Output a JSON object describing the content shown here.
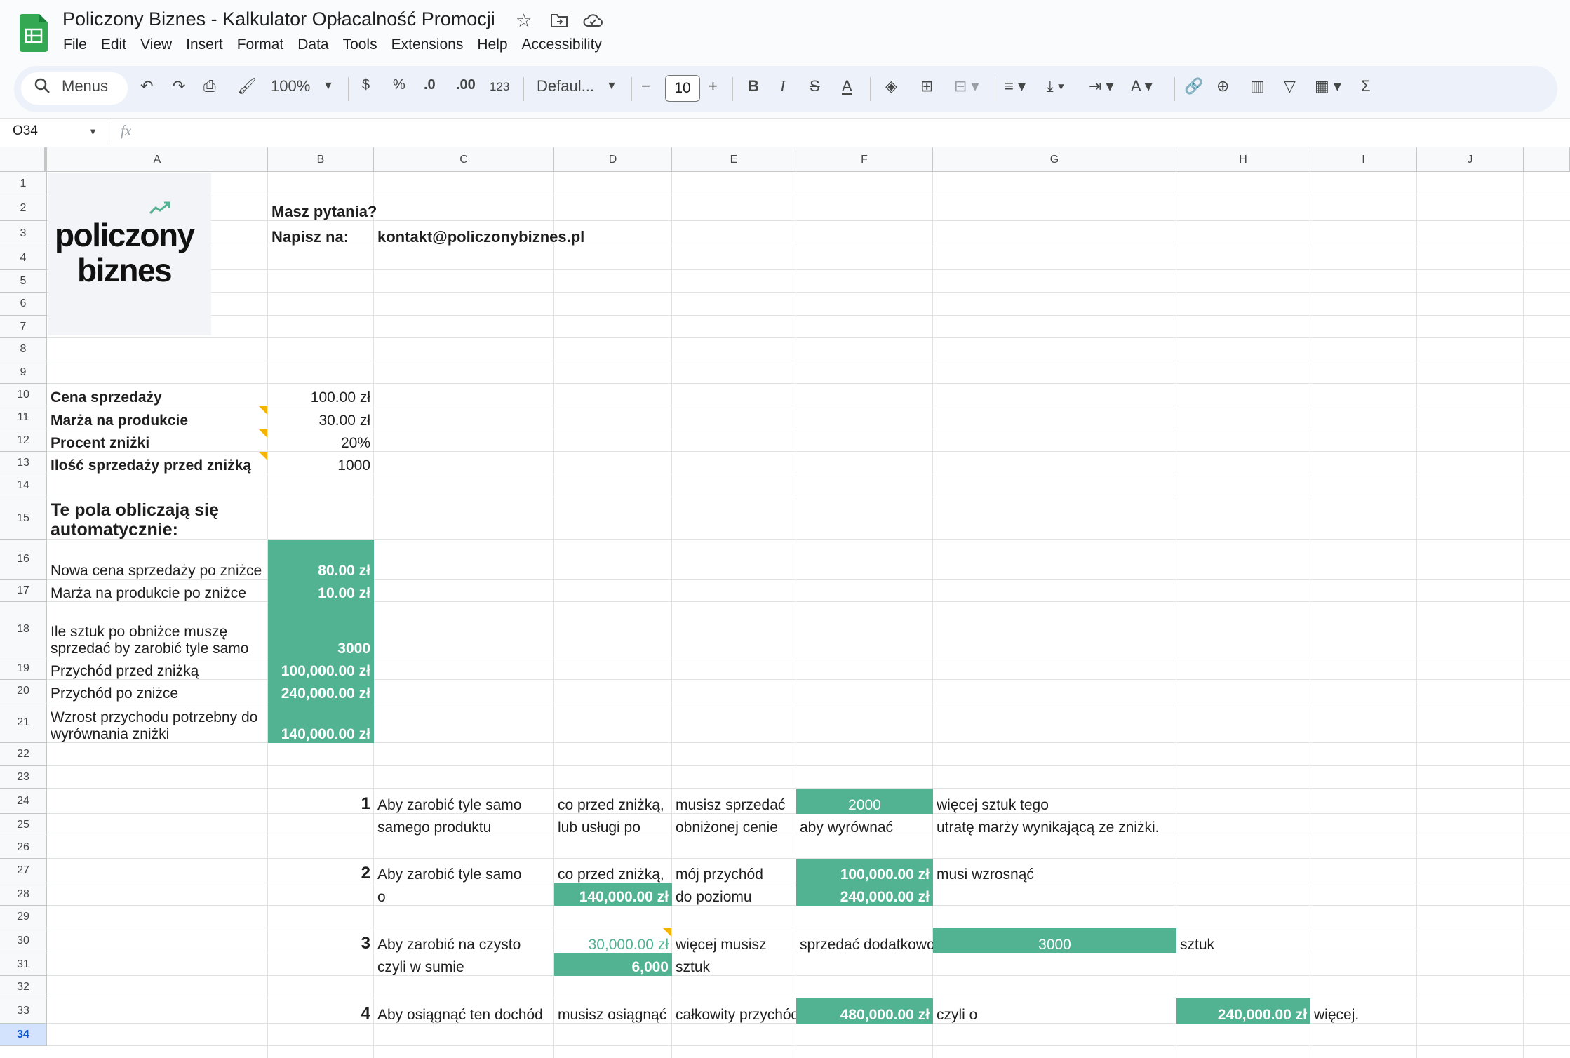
{
  "title": "Policzony Biznes - Kalkulator Opłacalność Promocji",
  "menu": [
    "File",
    "Edit",
    "View",
    "Insert",
    "Format",
    "Data",
    "Tools",
    "Extensions",
    "Help",
    "Accessibility"
  ],
  "toolbar": {
    "search": "Menus",
    "zoom": "100%",
    "currency": "$",
    "percent": "%",
    "dec_less": ".0",
    "dec_more": ".00",
    "num_format": "123",
    "font": "Defaul...",
    "font_size": "10",
    "bold": "B",
    "italic": "I"
  },
  "name_box": "O34",
  "fx": "fx",
  "columns": [
    "A",
    "B",
    "C",
    "D",
    "E",
    "F",
    "G",
    "H",
    "I",
    "J"
  ],
  "rows": [
    "1",
    "2",
    "3",
    "4",
    "5",
    "6",
    "7",
    "8",
    "9",
    "10",
    "11",
    "12",
    "13",
    "14",
    "15",
    "16",
    "17",
    "18",
    "19",
    "20",
    "21",
    "22",
    "23",
    "24",
    "25",
    "26",
    "27",
    "28",
    "29",
    "30",
    "31",
    "32",
    "33",
    "34"
  ],
  "logo": {
    "line1": "policzony",
    "line2": "biznes"
  },
  "contact": {
    "q": "Masz pytania?",
    "write": "Napisz na:",
    "email": "kontakt@policzonybiznes.pl"
  },
  "inputs": {
    "price_label": "Cena sprzedaży",
    "price": "100.00 zł",
    "margin_label": "Marża na produkcie",
    "margin": "30.00 zł",
    "discount_label": "Procent zniżki",
    "discount": "20%",
    "qty_label": "Ilość sprzedaży przed zniżką",
    "qty": "1000"
  },
  "auto": {
    "heading": "Te pola obliczają się automatycznie:",
    "new_price_label": "Nowa cena sprzedaży po zniżce",
    "new_price": "80.00 zł",
    "new_margin_label": "Marża na produkcie po zniżce",
    "new_margin": "10.00 zł",
    "units_label": "Ile sztuk po obniżce muszę sprzedać by zarobić tyle samo",
    "units": "3000",
    "rev_before_label": "Przychód przed zniżką",
    "rev_before": "100,000.00 zł",
    "rev_after_label": "Przychód po zniżce",
    "rev_after": "240,000.00 zł",
    "rev_growth_label": "Wzrost przychodu potrzebny do wyrównania zniżki",
    "rev_growth": "140,000.00 zł"
  },
  "s1": {
    "n": "1",
    "c24": "Aby zarobić tyle samo",
    "d24": "co przed zniżką,",
    "e24": "musisz sprzedać",
    "f24": "2000",
    "g24": "więcej sztuk tego",
    "c25": "samego produktu",
    "d25": "lub usługi po",
    "e25": "obniżonej cenie",
    "f25": "aby wyrównać",
    "g25": "utratę marży wynikającą ze zniżki."
  },
  "s2": {
    "n": "2",
    "c27": "Aby zarobić tyle samo",
    "d27": "co przed zniżką,",
    "e27": "mój przychód",
    "f27": "100,000.00 zł",
    "g27": "musi wzrosnąć",
    "c28": "o",
    "d28": "140,000.00 zł",
    "e28": "do poziomu",
    "f28": "240,000.00 zł"
  },
  "s3": {
    "n": "3",
    "c30": "Aby zarobić na czysto",
    "d30": "30,000.00 zł",
    "e30": "więcej musisz",
    "f30": "sprzedać dodatkowo",
    "g30": "3000",
    "h30": "sztuk",
    "c31": "czyli w sumie",
    "d31": "6,000",
    "e31": "sztuk"
  },
  "s4": {
    "n": "4",
    "c33": "Aby osiągnąć ten dochód",
    "d33": "musisz osiągnąć",
    "e33": "całkowity przychód",
    "f33": "480,000.00 zł",
    "g33": "czyli o",
    "h33": "240,000.00 zł",
    "i33": "więcej."
  },
  "colors": {
    "green": "#52b393",
    "accent": "#0b57d0"
  }
}
